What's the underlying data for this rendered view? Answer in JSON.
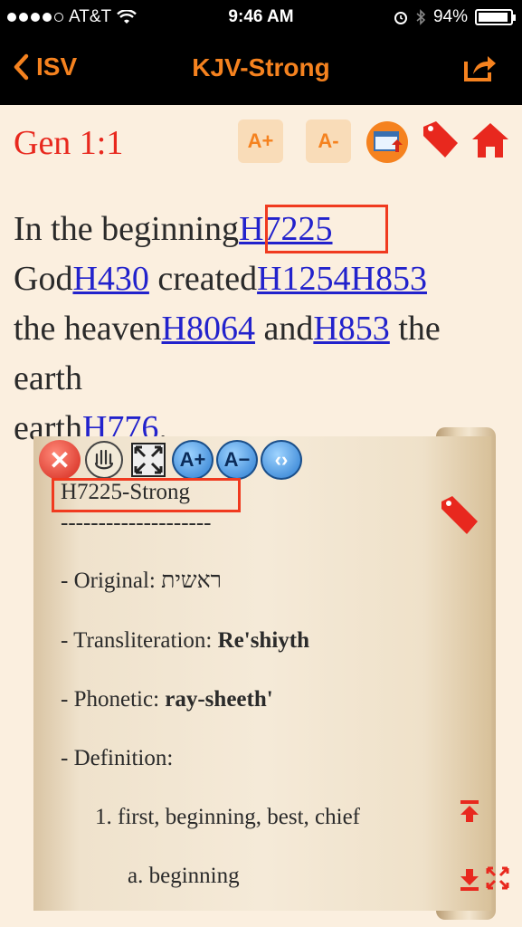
{
  "status": {
    "carrier": "AT&T",
    "time": "9:46 AM",
    "battery": "94%",
    "battery_level": 0.94
  },
  "nav": {
    "back_label": "ISV",
    "title": "KJV-Strong"
  },
  "verse": {
    "reference": "Gen 1:1",
    "font_increase": "A+",
    "font_decrease": "A-",
    "segments": [
      {
        "text": "In the beginning",
        "link": "H7225"
      },
      {
        "text": "God",
        "link": "H430"
      },
      {
        "text": " created",
        "link": "H1254H853"
      },
      {
        "text": "the heaven",
        "link": "H8064"
      },
      {
        "text": " and",
        "link": "H853"
      },
      {
        "text": " the earth",
        "link": "H776"
      }
    ],
    "period": "."
  },
  "panel": {
    "tool_font_increase": "A+",
    "tool_font_decrease": "A−",
    "heading": "H7225-Strong",
    "divider": "--------------------",
    "original_label": "- Original: ",
    "original_value": "ראשית",
    "transliteration_label": "- Transliteration: ",
    "transliteration_value": "Re'shiyth",
    "phonetic_label": "- Phonetic: ",
    "phonetic_value": "ray-sheeth'",
    "definition_label": "- Definition:",
    "def_1": "1. first, beginning, best, chief",
    "def_1a": "a. beginning"
  },
  "colors": {
    "accent": "#f5821f",
    "red": "#e8281e",
    "link": "#2222cc",
    "background": "#fbefdf"
  }
}
